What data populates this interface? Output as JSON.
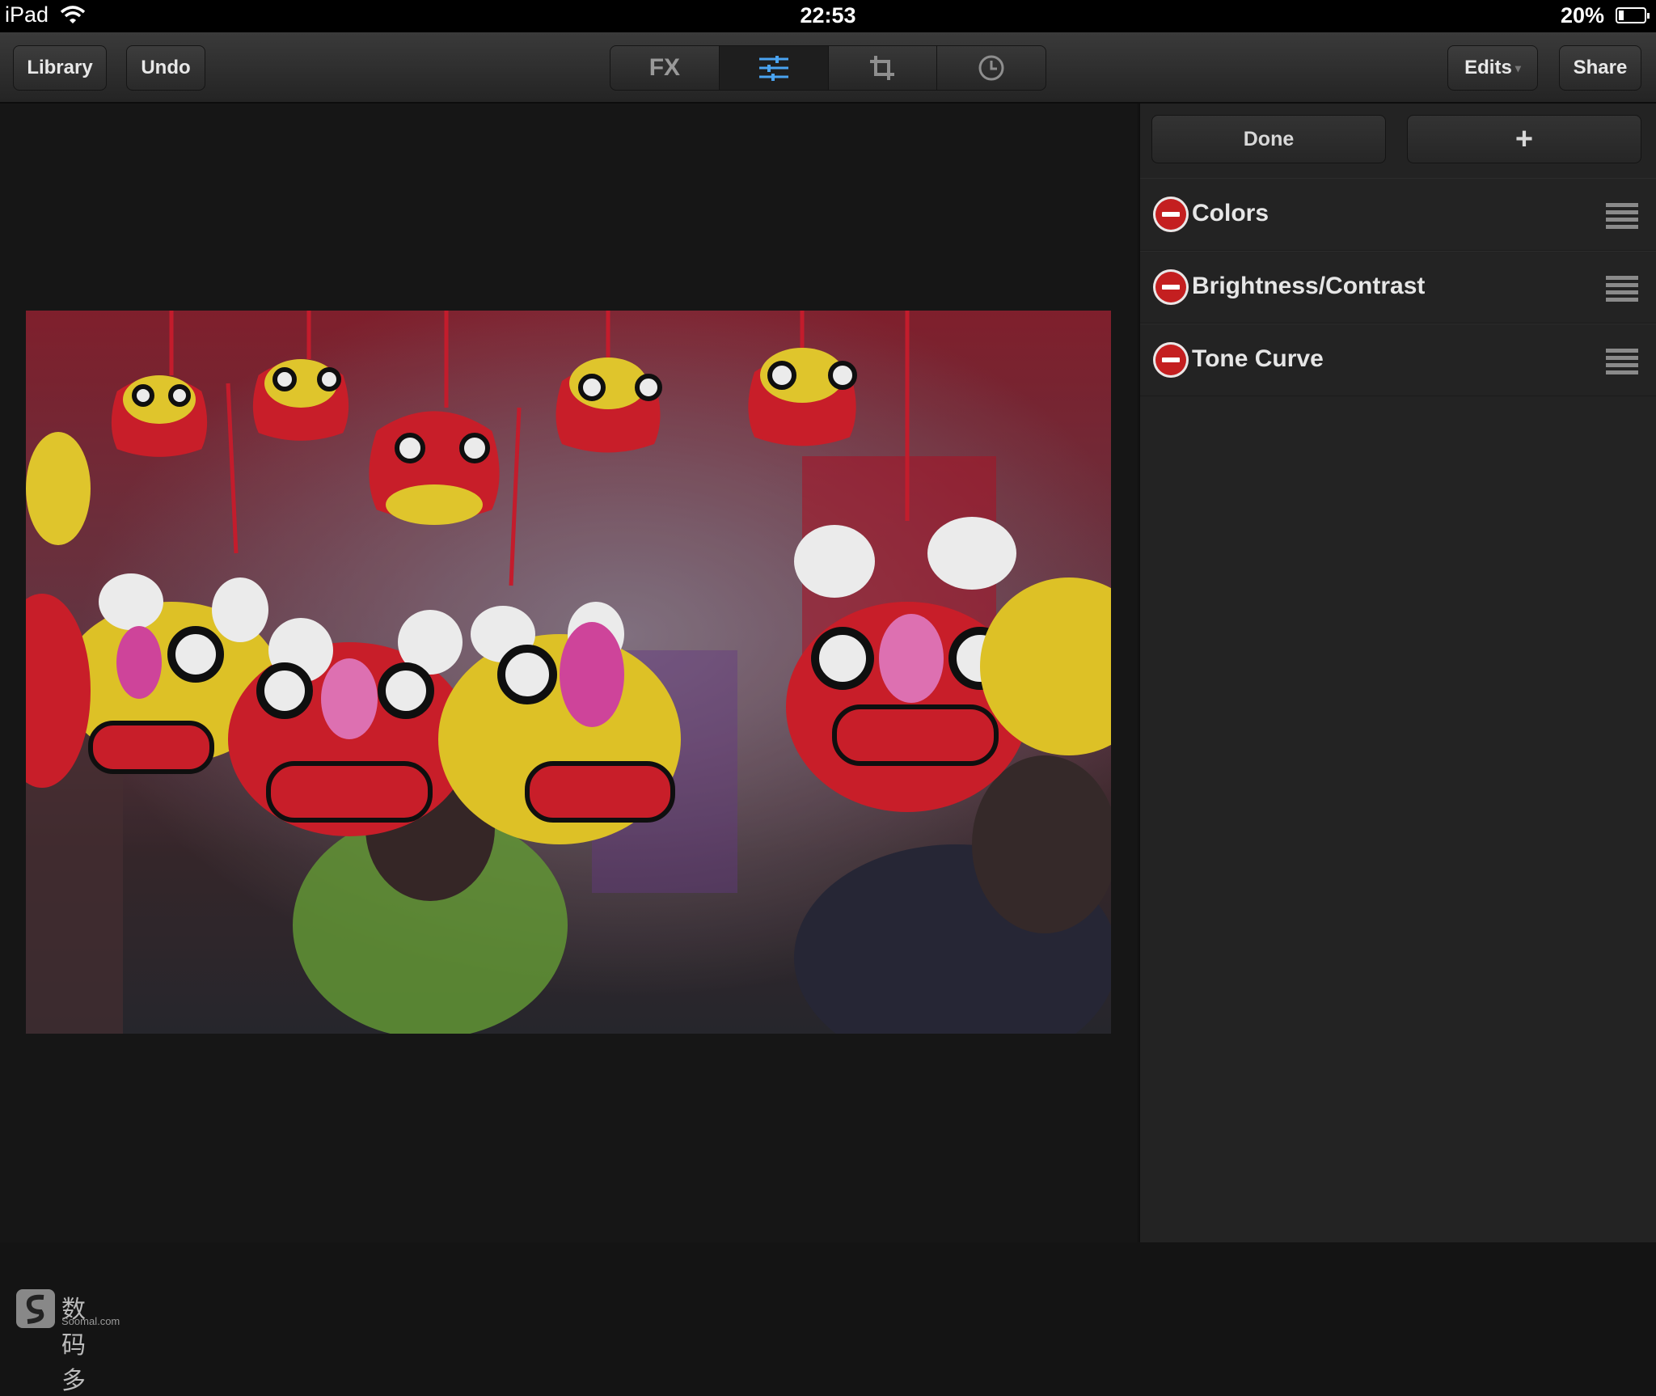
{
  "status": {
    "device": "iPad",
    "time": "22:53",
    "battery": "20%",
    "battery_level": 0.2
  },
  "toolbar": {
    "library": "Library",
    "undo": "Undo",
    "segments": [
      {
        "label": "FX",
        "icon": "fx"
      },
      {
        "label": "",
        "icon": "sliders-icon",
        "active": true
      },
      {
        "label": "",
        "icon": "crop-icon"
      },
      {
        "label": "",
        "icon": "history-clock-icon"
      }
    ],
    "edits": "Edits",
    "share": "Share"
  },
  "panel": {
    "done": "Done",
    "add": "+",
    "adjustments": [
      {
        "label": "Colors"
      },
      {
        "label": "Brightness/Contrast"
      },
      {
        "label": "Tone Curve"
      }
    ]
  },
  "watermark": {
    "text": "数码多",
    "sub": "Soomal.com"
  },
  "colors": {
    "accent_blue": "#4aa3f0",
    "remove_red": "#c41f20"
  }
}
